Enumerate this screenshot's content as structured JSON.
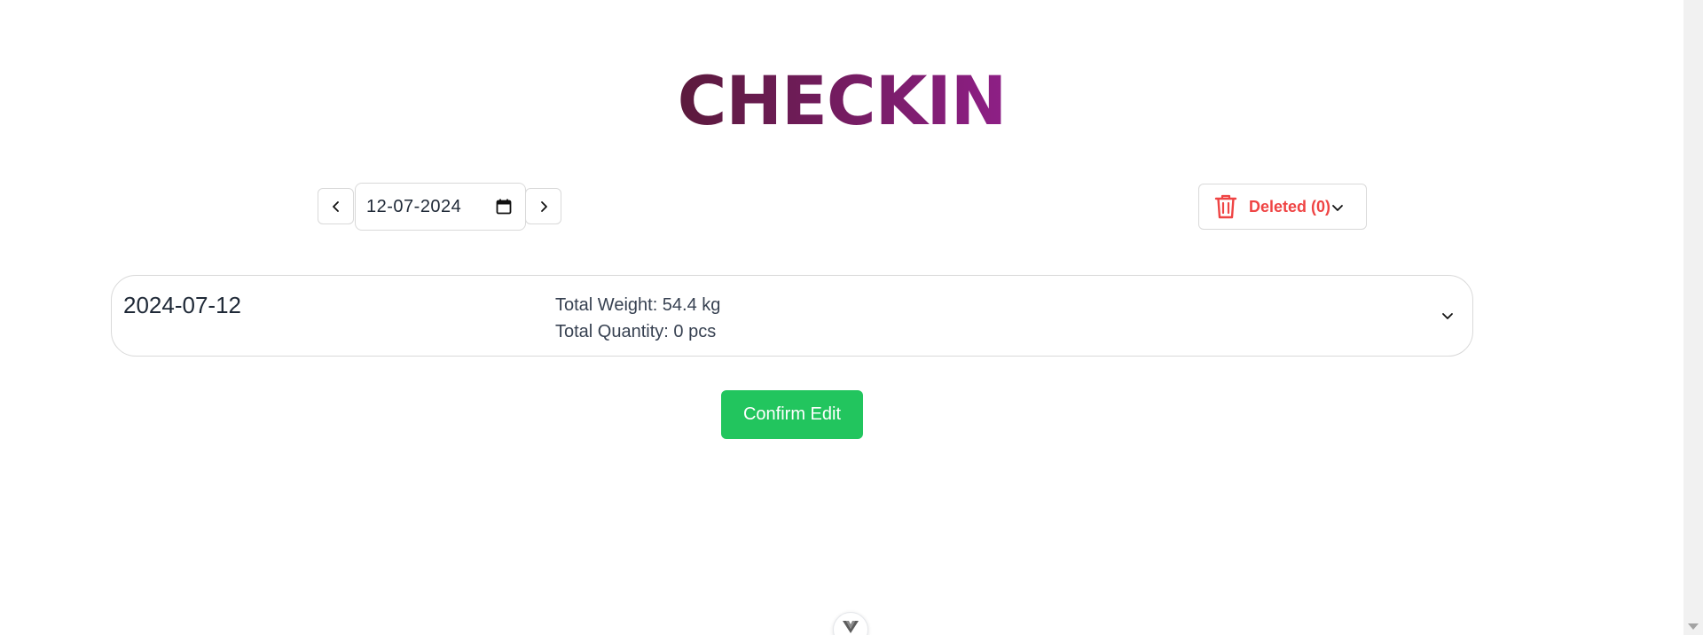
{
  "header": {
    "title": "CHECKIN"
  },
  "date_picker": {
    "value": "12-07-2024",
    "prev_icon": "chevron-left-icon",
    "next_icon": "chevron-right-icon",
    "calendar_icon": "calendar-icon"
  },
  "deleted": {
    "label": "Deleted (0)",
    "icon": "trash-icon",
    "color": "#ef4444"
  },
  "entry": {
    "date": "2024-07-12",
    "total_weight": "Total Weight: 54.4 kg",
    "total_quantity": "Total Quantity: 0 pcs"
  },
  "actions": {
    "confirm_label": "Confirm Edit",
    "confirm_color": "#22c55e"
  },
  "colors": {
    "title_gradient_start": "#5b1a3c",
    "title_gradient_end": "#8e1f86"
  }
}
